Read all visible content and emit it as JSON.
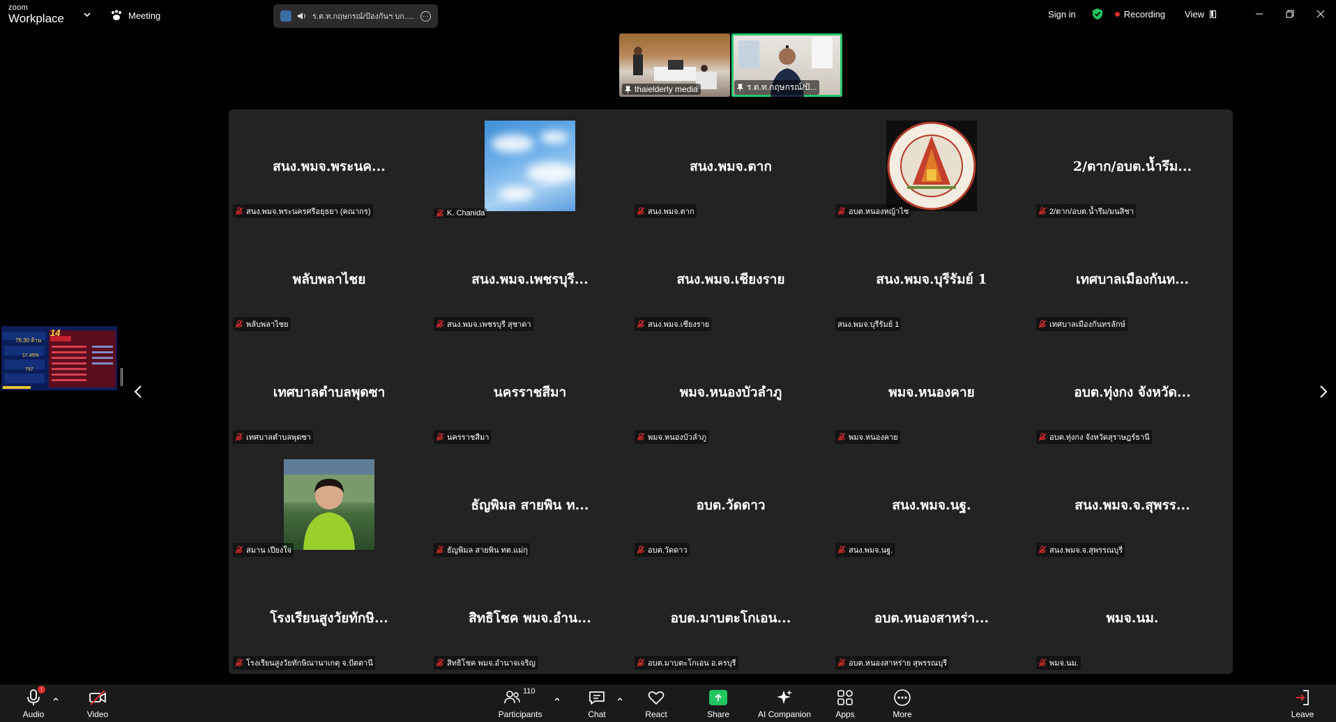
{
  "app": {
    "brand_small": "zoom",
    "brand_big": "Workplace"
  },
  "header": {
    "meeting_label": "Meeting",
    "speaker": "ร.ต.ท.กฤษกรณ์/ป้องกันฯ บก.ตอ",
    "sign_in": "Sign in",
    "recording": "Recording",
    "view": "View"
  },
  "videos": [
    {
      "name": "thaielderly media",
      "active": false
    },
    {
      "name": "ร.ต.ท.กฤษกรณ์/ป้...",
      "active": true
    }
  ],
  "tiles": [
    {
      "title": "สนง.พมจ.พระนค...",
      "name": "สนง.พมจ.พระนครศรีอยุธยา (คณากร)",
      "muted": true
    },
    {
      "title": "",
      "name": "K. Chanida",
      "muted": true,
      "image": "sky"
    },
    {
      "title": "สนง.พมจ.ตาก",
      "name": "สนง.พมจ.ตาก",
      "muted": true
    },
    {
      "title": "",
      "name": "อบต.หนองหญ้าไซ",
      "muted": true,
      "image": "seal"
    },
    {
      "title": "2/ตาก/อบต.น้ำรึม...",
      "name": "2/ตาก/อบต.น้ำรึม/มนสิชา",
      "muted": true
    },
    {
      "title": "พลับพลาไชย",
      "name": "พลับพลาไชย",
      "muted": true
    },
    {
      "title": "สนง.พมจ.เพชรบุรี...",
      "name": "สนง.พมจ.เพชรบุรี สุชาดา",
      "muted": true
    },
    {
      "title": "สนง.พมจ.เชียงราย",
      "name": "สนง.พมจ.เชียงราย",
      "muted": true
    },
    {
      "title": "สนง.พมจ.บุรีรัมย์ 1",
      "name": "สนง.พมจ.บุรีรัมย์ 1",
      "muted": false
    },
    {
      "title": "เทศบาลเมืองกันท...",
      "name": "เทศบาลเมืองกันทรลักษ์",
      "muted": true
    },
    {
      "title": "เทศบาลตำบลพุดซา",
      "name": "เทศบาลตำบลพุดซา",
      "muted": true
    },
    {
      "title": "นครราชสีมา",
      "name": "นครราชสีมา",
      "muted": true
    },
    {
      "title": "พมจ.หนองบัวลำภู",
      "name": "พมจ.หนองบัวลำภู",
      "muted": true
    },
    {
      "title": "พมจ.หนองคาย",
      "name": "พมจ.หนองคาย",
      "muted": true
    },
    {
      "title": "อบต.ทุ่งกง จังหวัด...",
      "name": "อบต.ทุ่งกง จังหวัดสุราษฎร์ธานี",
      "muted": true
    },
    {
      "title": "",
      "name": "สมาน เปียงใจ",
      "muted": true,
      "image": "person"
    },
    {
      "title": "ธัญพิมล สายพิน ท...",
      "name": "ธัญพิมล สายพิน ทต.แม่กุ",
      "muted": true
    },
    {
      "title": "อบต.วัดดาว",
      "name": "อบต.วัดดาว",
      "muted": true
    },
    {
      "title": "สนง.พมจ.นฐ.",
      "name": "สนง.พมจ.นฐ.",
      "muted": true
    },
    {
      "title": "สนง.พมจ.จ.สุพรร...",
      "name": "สนง.พมจ.จ.สุพรรณบุรี",
      "muted": true
    },
    {
      "title": "โรงเรียนสูงวัยทักษิ...",
      "name": "โรงเรียนสูงวัยทักษิณานาเกตุ จ.ปัตตานี",
      "muted": true
    },
    {
      "title": "สิทธิโชค พมจ.อำน...",
      "name": "สิทธิโชค พมจ.อำนาจเจริญ",
      "muted": true
    },
    {
      "title": "อบต.มาบตะโกเอน...",
      "name": "อบต.มาบตะโกเอน อ.ครบุรี",
      "muted": true
    },
    {
      "title": "อบต.หนองสาหร่า...",
      "name": "อบต.หนองสาหร่าย สุพรรณบุรี",
      "muted": true
    },
    {
      "title": "พมจ.นม.",
      "name": "พมจ.นม.",
      "muted": true
    }
  ],
  "shared_screen": {
    "day": "14",
    "value": "76.30 ล้าน",
    "percent": "17.45%",
    "count": "757"
  },
  "toolbar": {
    "audio": "Audio",
    "video": "Video",
    "participants": "Participants",
    "participants_count": "110",
    "chat": "Chat",
    "react": "React",
    "share": "Share",
    "ai_companion": "AI Companion",
    "apps": "Apps",
    "more": "More",
    "leave": "Leave"
  },
  "colors": {
    "accent_green": "#28c76f",
    "share_green": "#22c55e",
    "mute_red": "#e02d2d",
    "panel": "#232323"
  }
}
